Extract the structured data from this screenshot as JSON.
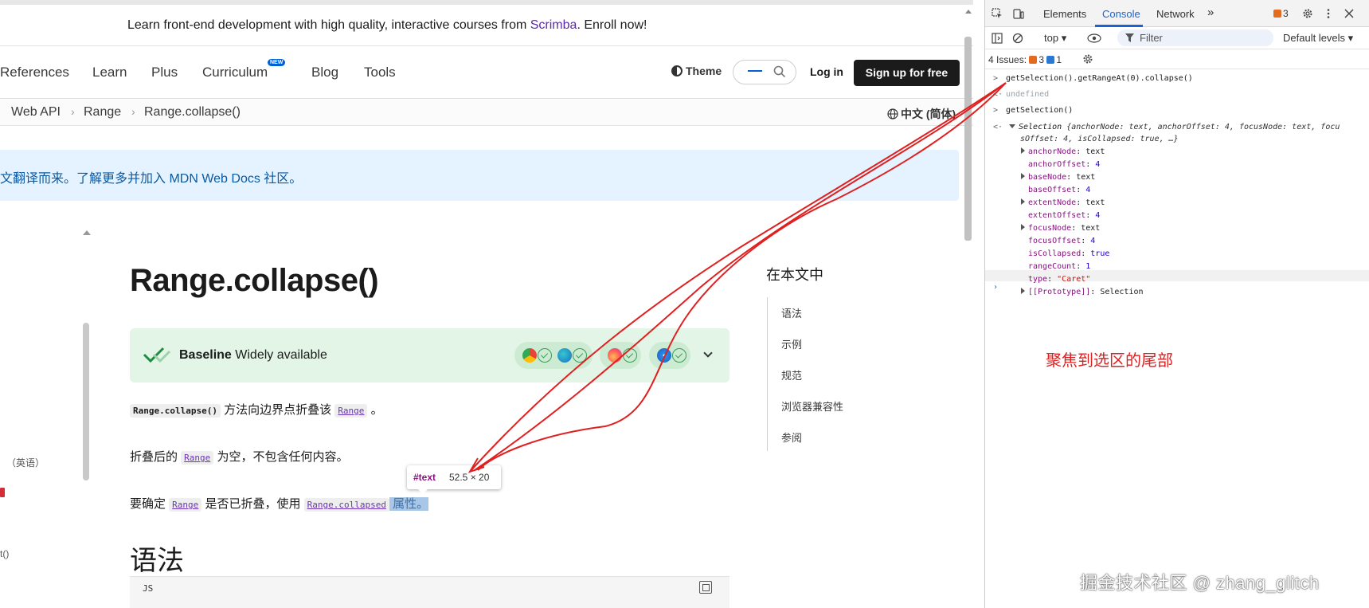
{
  "promo": {
    "prefix": "Learn front-end development with high quality, interactive courses from ",
    "brand": "Scrimba",
    "suffix": ". Enroll now!"
  },
  "nav": {
    "items": [
      "References",
      "Learn",
      "Plus",
      "Curriculum",
      "Blog",
      "Tools"
    ],
    "new_badge": "NEW",
    "theme": "Theme",
    "login": "Log in",
    "signup": "Sign up for free"
  },
  "breadcrumb": {
    "items": [
      "Web API",
      "Range",
      "Range.collapse()"
    ],
    "sep": "›",
    "language": "中文 (简体)"
  },
  "notice": "文翻译而来。了解更多并加入 MDN Web Docs 社区。",
  "sidebar_fragments": [
    "（英语）",
    "t()"
  ],
  "article": {
    "title": "Range.collapse()",
    "baseline_bold": "Baseline",
    "baseline_rest": " Widely available",
    "p1_code": "Range.collapse()",
    "p1_text": " 方法向边界点折叠该 ",
    "p1_link": "Range",
    "p1_end": " 。",
    "p2_start": "折叠后的 ",
    "p2_link": "Range",
    "p2_end": " 为空，不包含任何内容。",
    "p3_start": "要确定 ",
    "p3_link1": "Range",
    "p3_mid": " 是否已折叠，使用 ",
    "p3_link2": "Range.collapsed",
    "p3_sel": " 属性。",
    "h2": "语法",
    "code_lang": "JS"
  },
  "tooltip": {
    "tag": "#text",
    "dims": "52.5 × 20"
  },
  "toc": {
    "title": "在本文中",
    "items": [
      "语法",
      "示例",
      "规范",
      "浏览器兼容性",
      "参阅"
    ]
  },
  "devtools": {
    "tabs": [
      "Elements",
      "Console",
      "Network"
    ],
    "more": "»",
    "issues_count": "3",
    "context": "top",
    "filter_placeholder": "Filter",
    "levels": "Default levels",
    "issues_label": "4 Issues:",
    "issues_warn": "3",
    "issues_info": "1",
    "console": {
      "cmd1": "getSelection().getRangeAt(0).collapse()",
      "res1": "undefined",
      "cmd2": "getSelection()",
      "obj_head": "Selection",
      "obj_summary_1": "{anchorNode: text, anchorOffset: 4, focusNode: text, focu",
      "obj_summary_2": "sOffset: 4, isCollapsed: true, …}",
      "props": [
        {
          "key": "anchorNode",
          "val": "text",
          "expandable": true
        },
        {
          "key": "anchorOffset",
          "val": "4",
          "expandable": false
        },
        {
          "key": "baseNode",
          "val": "text",
          "expandable": true
        },
        {
          "key": "baseOffset",
          "val": "4",
          "expandable": false
        },
        {
          "key": "extentNode",
          "val": "text",
          "expandable": true
        },
        {
          "key": "extentOffset",
          "val": "4",
          "expandable": false
        },
        {
          "key": "focusNode",
          "val": "text",
          "expandable": true
        },
        {
          "key": "focusOffset",
          "val": "4",
          "expandable": false
        },
        {
          "key": "isCollapsed",
          "val": "true",
          "expandable": false
        },
        {
          "key": "rangeCount",
          "val": "1",
          "expandable": false
        },
        {
          "key": "type",
          "val": "\"Caret\"",
          "expandable": false
        },
        {
          "key": "[[Prototype]]",
          "val": "Selection",
          "expandable": true
        }
      ]
    }
  },
  "annotation": "聚焦到选区的尾部",
  "watermark": "掘金技术社区 @ zhang_glitch",
  "colors": {
    "accent": "#1a63d4",
    "annotation_red": "#e02020",
    "brand_purple": "#5b2ba8"
  }
}
